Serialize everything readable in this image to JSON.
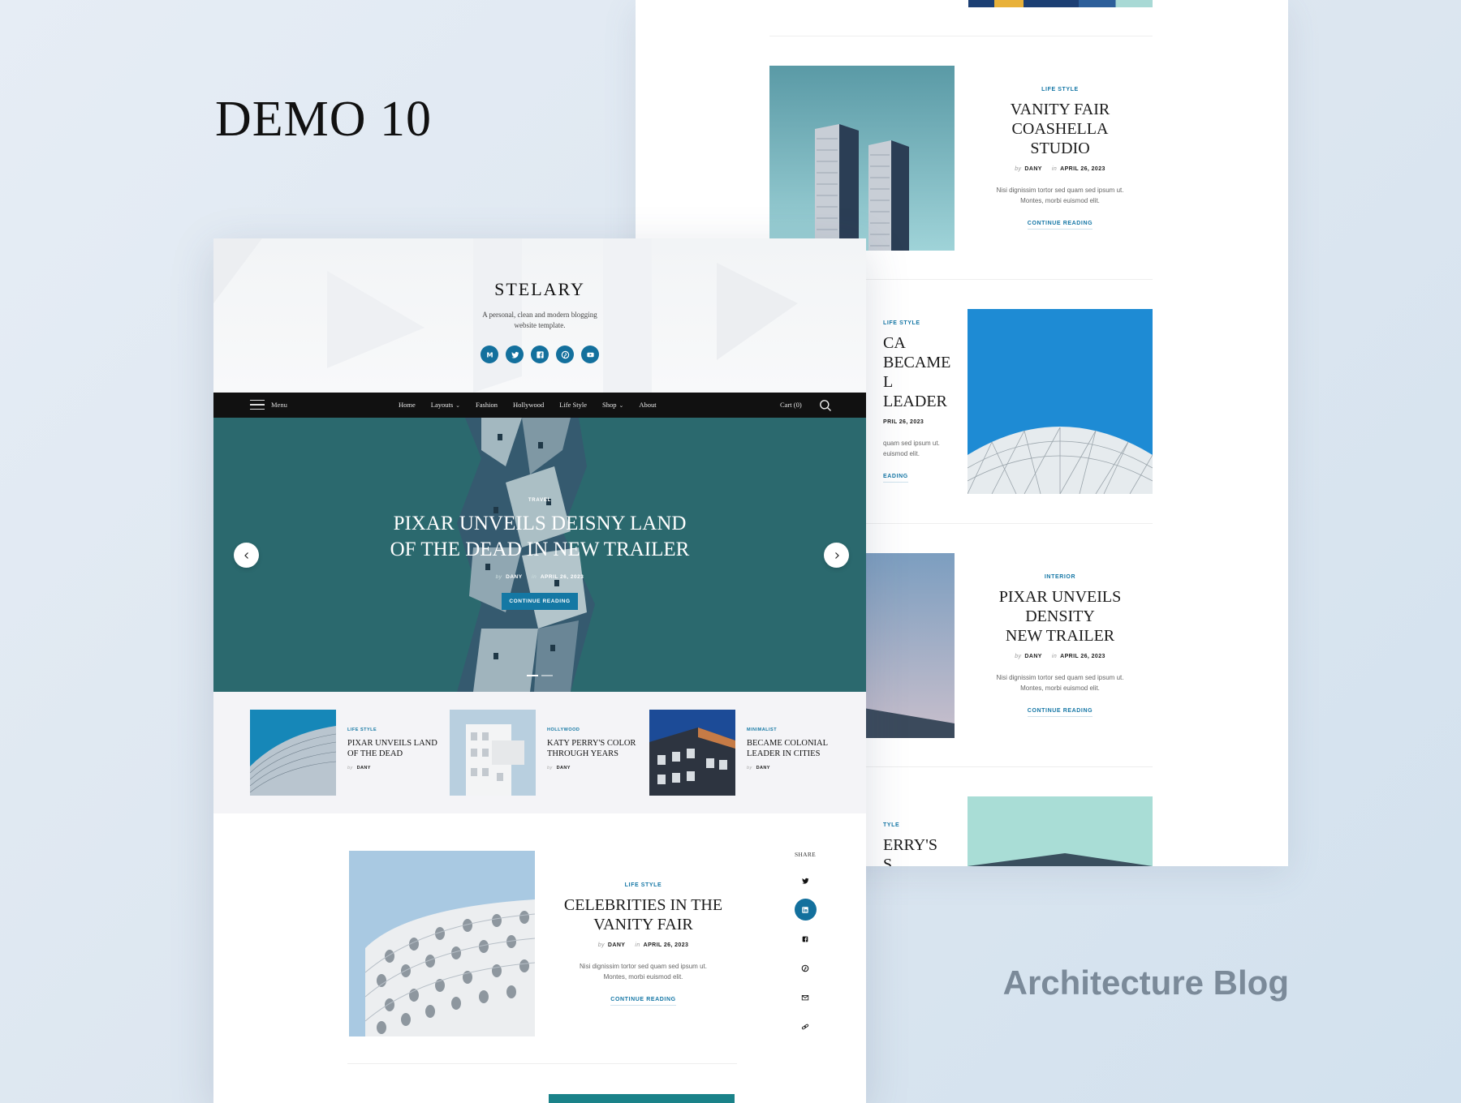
{
  "showcase": {
    "demo_label": "DEMO 10",
    "subtitle": "Architecture Blog"
  },
  "site": {
    "brand": "STELARY",
    "tagline_line1": "A personal, clean and modern blogging",
    "tagline_line2": "website template.",
    "socials": [
      "medium-icon",
      "twitter-icon",
      "facebook-icon",
      "pinterest-icon",
      "youtube-icon"
    ]
  },
  "nav": {
    "menu_label": "Menu",
    "links": [
      "Home",
      "Layouts",
      "Fashion",
      "Hollywood",
      "Life Style",
      "Shop",
      "About"
    ],
    "cart": "Cart (0)"
  },
  "hero": {
    "category": "TRAVEL",
    "title_line1": "PIXAR UNVEILS DEISNY LAND",
    "title_line2": "OF THE DEAD IN NEW TRAILER",
    "by": "by",
    "author": "DANY",
    "in": "in",
    "date": "APRIL 26, 2023",
    "button": "CONTINUE READING"
  },
  "mini_posts": [
    {
      "category": "LIFE STYLE",
      "title_line1": "PIXAR UNVEILS LAND",
      "title_line2": "OF THE DEAD",
      "by": "by",
      "author": "DANY"
    },
    {
      "category": "HOLLYWOOD",
      "title_line1": "KATY PERRY'S COLOR",
      "title_line2": "THROUGH YEARS",
      "by": "by",
      "author": "DANY"
    },
    {
      "category": "MINIMALIST",
      "title_line1": "BECAME COLONIAL",
      "title_line2": "LEADER IN CITIES",
      "by": "by",
      "author": "DANY"
    }
  ],
  "featured": {
    "category": "LIFE STYLE",
    "title_line1": "CELEBRITIES IN THE",
    "title_line2": "VANITY FAIR",
    "by": "by",
    "author": "DANY",
    "in": "in",
    "date": "APRIL 26, 2023",
    "excerpt_line1": "Nisi dignissim tortor sed quam sed ipsum ut.",
    "excerpt_line2": "Montes, morbi euismod elit.",
    "cta": "CONTINUE READING"
  },
  "share": {
    "label": "SHARE",
    "icons": [
      "twitter-icon",
      "linkedin-icon",
      "facebook-icon",
      "pinterest-icon",
      "mail-icon",
      "link-icon"
    ]
  },
  "back_posts": [
    {
      "category": "LIFE STYLE",
      "title_line1": "VANITY FAIR COASHELLA",
      "title_line2": "STUDIO",
      "by": "by",
      "author": "DANY",
      "in": "in",
      "date": "APRIL 26, 2023",
      "excerpt_line1": "Nisi dignissim tortor sed quam sed ipsum ut.",
      "excerpt_line2": "Montes, morbi euismod elit.",
      "cta": "CONTINUE READING"
    },
    {
      "category": "LIFE STYLE",
      "title_line1": "CA BECAME",
      "title_line2": "L LEADER",
      "date": "PRIL 26, 2023",
      "excerpt_line1": "quam sed ipsum ut.",
      "excerpt_line2": "euismod elit.",
      "cta": "EADING"
    },
    {
      "category": "INTERIOR",
      "title_line1": "PIXAR UNVEILS DENSITY",
      "title_line2": "NEW TRAILER",
      "by": "by",
      "author": "DANY",
      "in": "in",
      "date": "APRIL 26, 2023",
      "excerpt_line1": "Nisi dignissim tortor sed quam sed ipsum ut.",
      "excerpt_line2": "Montes, morbi euismod elit.",
      "cta": "CONTINUE READING"
    },
    {
      "category": "TYLE",
      "title_line1": "ERRY'S",
      "title_line2": "S COLORS"
    }
  ],
  "colors": {
    "accent": "#1478a4",
    "nav_bg": "#111111",
    "hero_bg": "#2f6d72"
  }
}
